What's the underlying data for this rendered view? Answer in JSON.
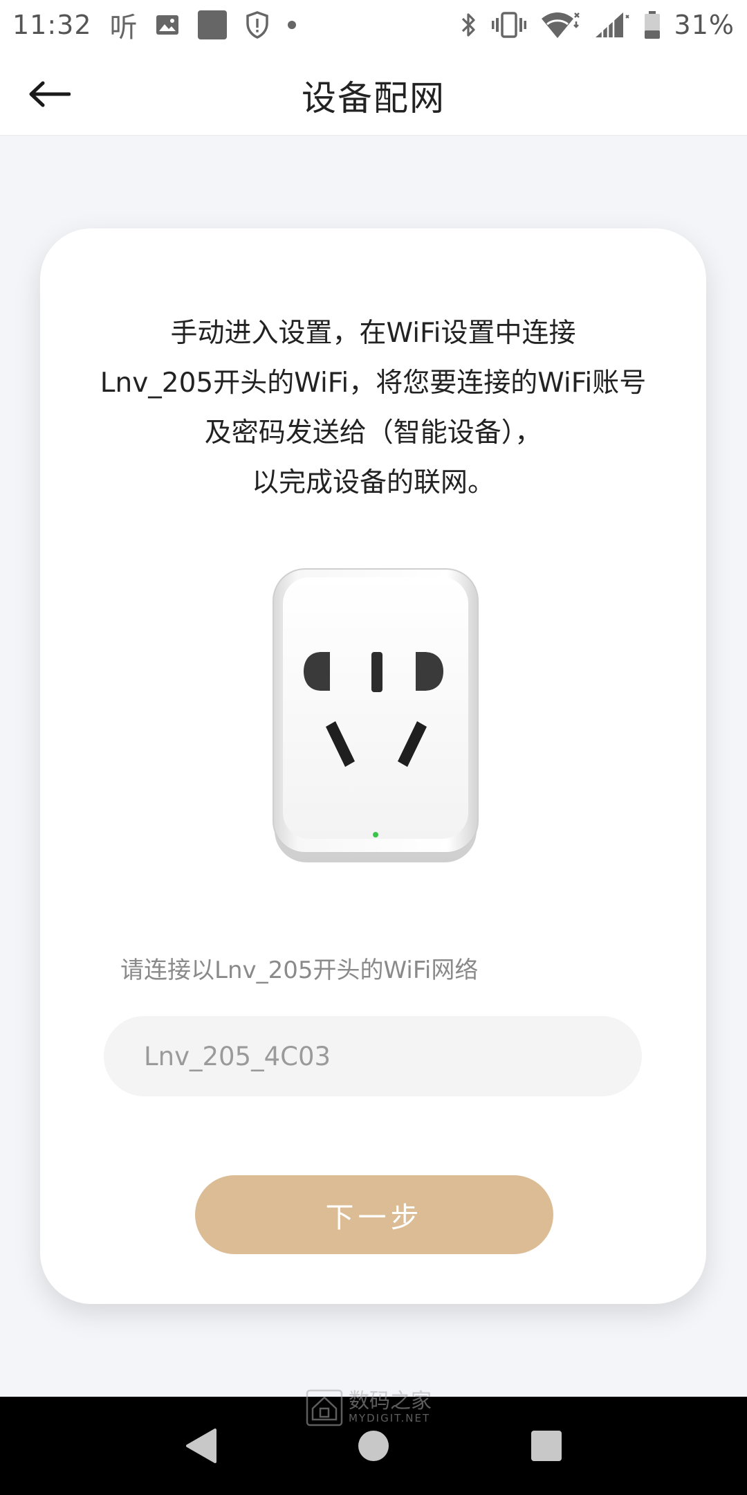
{
  "status_bar": {
    "time": "11:32",
    "app_icon_text": "听",
    "battery": "31%",
    "icons": [
      "ting-app-icon",
      "image-icon",
      "square-app-icon",
      "shield-alert-icon",
      "dot-icon",
      "bluetooth-icon",
      "vibrate-icon",
      "wifi-icon",
      "signal-icon",
      "battery-icon"
    ]
  },
  "header": {
    "title": "设备配网",
    "back_icon": "arrow-left-icon"
  },
  "card": {
    "instructions": [
      "手动进入设置，在WiFi设置中连接",
      "Lnv_205开头的WiFi，将您要连接的WiFi账号",
      "及密码发送给（智能设备），",
      "以完成设备的联网。"
    ],
    "illustration": "smart-plug-image",
    "wifi_hint": "请连接以Lnv_205开头的WiFi网络",
    "ssid_value": "Lnv_205_4C03",
    "next_button": "下一步"
  },
  "watermark": {
    "text_cn": "数码之家",
    "text_en": "MYDIGIT.NET"
  },
  "nav_bar": {
    "icons": [
      "back-triangle-icon",
      "home-circle-icon",
      "recents-square-icon"
    ]
  },
  "colors": {
    "accent_button": "#dbbc94",
    "background": "#f4f5f8",
    "card": "#ffffff",
    "indicator_led": "#3cc44a"
  }
}
